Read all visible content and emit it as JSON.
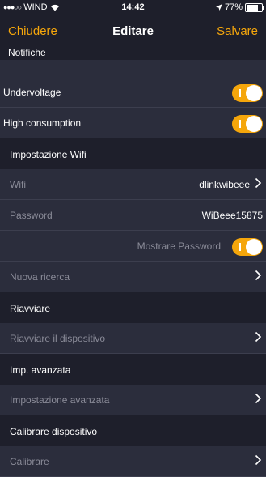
{
  "status_bar": {
    "carrier": "WIND",
    "time": "14:42",
    "battery": "77%",
    "battery_level": 0.77
  },
  "nav": {
    "close_label": "Chiudere",
    "title": "Editare",
    "save_label": "Salvare",
    "section_label": "Notifiche"
  },
  "notifications": {
    "undervoltage_label": "Undervoltage",
    "undervoltage_on": true,
    "high_consumption_label": "High consumption",
    "high_consumption_on": true
  },
  "wifi": {
    "header": "Impostazione Wifi",
    "wifi_label": "Wifi",
    "wifi_value": "dlinkwibeee",
    "password_label": "Password",
    "password_value": "WiBeee15875",
    "show_password_label": "Mostrare Password",
    "show_password_on": true,
    "new_search_label": "Nuova ricerca"
  },
  "restart": {
    "header": "Riavviare",
    "restart_device_label": "Riavviare il dispositivo"
  },
  "advanced": {
    "header": "Imp. avanzata",
    "advanced_settings_label": "Impostazione avanzata"
  },
  "calibrate": {
    "header": "Calibrare dispositivo",
    "calibrate_label": "Calibrare"
  },
  "colors": {
    "accent": "#f5a60b",
    "background": "#2b2d3c",
    "header_background": "#1e1f2b"
  }
}
